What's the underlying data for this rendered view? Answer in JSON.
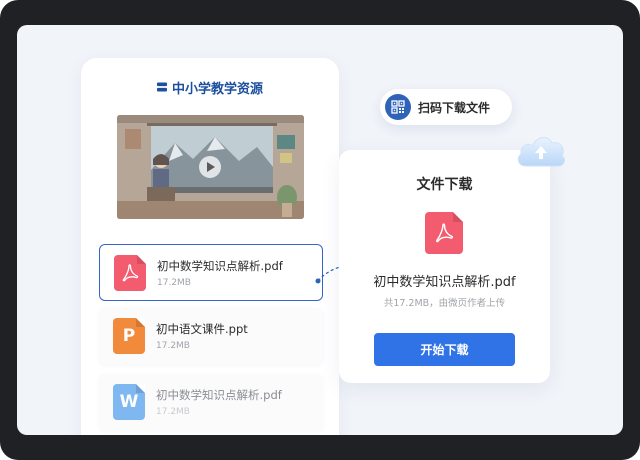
{
  "brand": {
    "name": "中小学教学资源",
    "icon": "stack-logo-icon"
  },
  "video": {
    "icon": "play-icon"
  },
  "files": [
    {
      "name": "初中数学知识点解析.pdf",
      "size": "17.2MB",
      "type": "pdf",
      "icon": "pdf-icon",
      "color": "#f25c6e",
      "selected": true
    },
    {
      "name": "初中语文课件.ppt",
      "size": "17.2MB",
      "type": "ppt",
      "icon": "ppt-icon",
      "glyph": "P",
      "color": "#f28a3c",
      "selected": false
    },
    {
      "name": "初中数学知识点解析.pdf",
      "size": "17.2MB",
      "type": "doc",
      "icon": "word-icon",
      "glyph": "W",
      "color": "#7fb7f0",
      "selected": false
    }
  ],
  "scan_pill": {
    "label": "扫码下载文件",
    "icon": "qr-code-icon"
  },
  "download_card": {
    "title": "文件下载",
    "file_name": "初中数学知识点解析.pdf",
    "meta": "共17.2MB，由微页作者上传",
    "button_label": "开始下载",
    "file_icon": "pdf-icon"
  },
  "cloud": {
    "icon": "cloud-upload-icon"
  },
  "colors": {
    "accent": "#2f73e6",
    "brand_blue": "#1d4fa0",
    "pdf_red": "#f25c6e",
    "ppt_orange": "#f28a3c",
    "word_blue": "#7fb7f0"
  }
}
